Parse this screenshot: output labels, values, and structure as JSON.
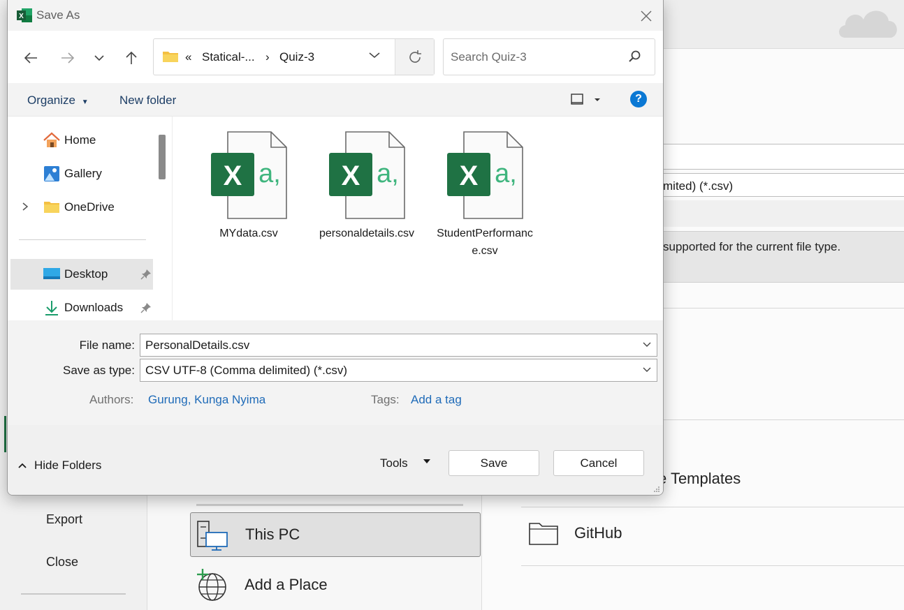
{
  "background": {
    "left_menu": [
      "Export",
      "Close"
    ],
    "places": {
      "this_pc": "This PC",
      "add_place": "Add a Place"
    },
    "right": {
      "file_type_partial": "mited) (*.csv)",
      "note_partial": "supported for the current file type.",
      "templates_partial": "e Templates",
      "github": "GitHub"
    }
  },
  "dialog": {
    "title": "Save As",
    "address": {
      "overflow": "«",
      "segments": [
        "Statical-...",
        "Quiz-3"
      ],
      "separator": "›"
    },
    "search": {
      "placeholder": "Search Quiz-3"
    },
    "toolbar": {
      "organize": "Organize",
      "new_folder": "New folder",
      "help": "?"
    },
    "nav_pane": [
      {
        "label": "Home",
        "icon": "home-icon"
      },
      {
        "label": "Gallery",
        "icon": "gallery-icon"
      },
      {
        "label": "OneDrive",
        "icon": "folder-icon"
      },
      {
        "label": "Desktop",
        "icon": "desktop-icon"
      },
      {
        "label": "Downloads",
        "icon": "download-icon"
      }
    ],
    "files": [
      {
        "name": "MYdata.csv"
      },
      {
        "name": "personaldetails.csv"
      },
      {
        "name": "StudentPerformance.csv"
      }
    ],
    "form": {
      "file_name_label": "File name:",
      "file_name_value": "PersonalDetails.csv",
      "save_type_label": "Save as type:",
      "save_type_value": "CSV UTF-8 (Comma delimited) (*.csv)",
      "authors_label": "Authors:",
      "authors_value": "Gurung, Kunga Nyima",
      "tags_label": "Tags:",
      "tags_value": "Add a tag"
    },
    "footer": {
      "hide_folders": "Hide Folders",
      "tools": "Tools",
      "save": "Save",
      "cancel": "Cancel"
    }
  },
  "colors": {
    "excel_green": "#1f7244",
    "link_blue": "#1f6bb8",
    "help_blue": "#0a78d4",
    "csv_green": "#3fb57e"
  }
}
